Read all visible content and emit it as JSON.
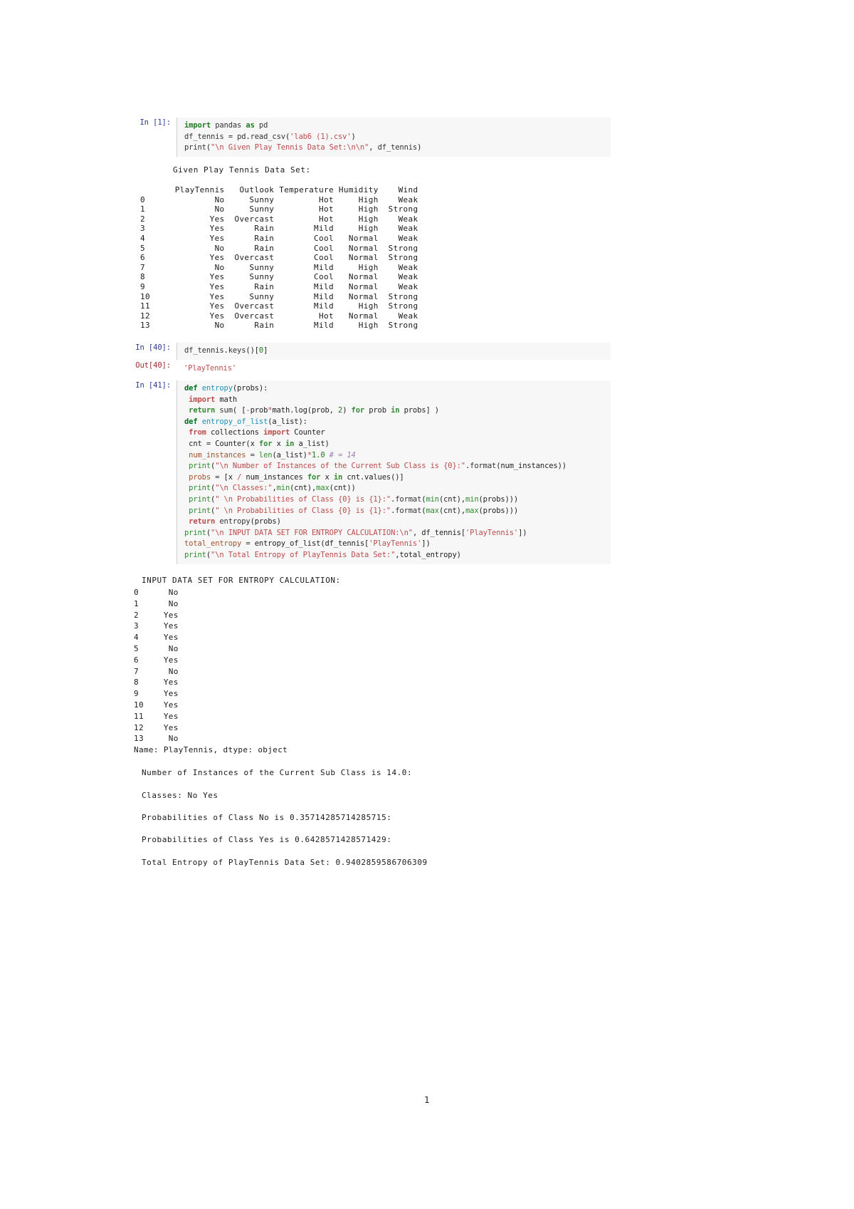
{
  "document": {
    "page_number": "1"
  },
  "cells": [
    {
      "prompt": "In [1]:",
      "code_lines": [
        "import pandas as pd",
        "df_tennis = pd.read_csv('lab6 (1).csv')",
        "print(\"\\n Given Play Tennis Data Set:\\n\\n\", df_tennis)"
      ]
    },
    {
      "prompt": "In [40]:",
      "code_lines": [
        "df_tennis.keys()[0]"
      ]
    },
    {
      "prompt": "Out[40]:",
      "code_lines": [
        "'PlayTennis'"
      ]
    },
    {
      "prompt": "In [41]:",
      "code_lines": [
        "def entropy(probs):",
        "  import math",
        "  return sum( [-prob*math.log(prob, 2) for prob in probs] )",
        "def entropy_of_list(a_list):",
        "  from collections import Counter",
        "  cnt = Counter(x for x in a_list)",
        "  num_instances = len(a_list)*1.0 # = 14",
        "  print(\"\\n Number of Instances of the Current Sub Class is {0}:\".format(num_instances))",
        "  probs = [x / num_instances for x in cnt.values()]",
        "  print(\"\\n Classes:\",min(cnt),max(cnt))",
        "  print(\" \\n Probabilities of Class {0} is {1}:\".format(min(cnt),min(probs)))",
        "  print(\" \\n Probabilities of Class {0} is {1}:\".format(max(cnt),max(probs)))",
        "  return entropy(probs)",
        "print(\"\\n INPUT DATA SET FOR ENTROPY CALCULATION:\\n\", df_tennis['PlayTennis'])",
        "total_entropy = entropy_of_list(df_tennis['PlayTennis'])",
        "print(\"\\n Total Entropy of PlayTennis Data Set:\",total_entropy)"
      ]
    }
  ],
  "output_dataset": {
    "title": "Given Play Tennis Data Set:",
    "columns": [
      "PlayTennis",
      "Outlook",
      "Temperature",
      "Humidity",
      "Wind"
    ],
    "index": [
      "0",
      "1",
      "2",
      "3",
      "4",
      "5",
      "6",
      "7",
      "8",
      "9",
      "10",
      "11",
      "12",
      "13"
    ],
    "rows": [
      [
        "No",
        "Sunny",
        "Hot",
        "High",
        "Weak"
      ],
      [
        "No",
        "Sunny",
        "Hot",
        "High",
        "Strong"
      ],
      [
        "Yes",
        "Overcast",
        "Hot",
        "High",
        "Weak"
      ],
      [
        "Yes",
        "Rain",
        "Mild",
        "High",
        "Weak"
      ],
      [
        "Yes",
        "Rain",
        "Cool",
        "Normal",
        "Weak"
      ],
      [
        "No",
        "Rain",
        "Cool",
        "Normal",
        "Strong"
      ],
      [
        "Yes",
        "Overcast",
        "Cool",
        "Normal",
        "Strong"
      ],
      [
        "No",
        "Sunny",
        "Mild",
        "High",
        "Weak"
      ],
      [
        "Yes",
        "Sunny",
        "Cool",
        "Normal",
        "Weak"
      ],
      [
        "Yes",
        "Rain",
        "Mild",
        "Normal",
        "Weak"
      ],
      [
        "Yes",
        "Sunny",
        "Mild",
        "Normal",
        "Strong"
      ],
      [
        "Yes",
        "Overcast",
        "Mild",
        "High",
        "Strong"
      ],
      [
        "Yes",
        "Overcast",
        "Hot",
        "Normal",
        "Weak"
      ],
      [
        "No",
        "Rain",
        "Mild",
        "High",
        "Strong"
      ]
    ],
    "text": "       PlayTennis   Outlook Temperature Humidity    Wind\n0              No     Sunny         Hot     High    Weak\n1              No     Sunny         Hot     High  Strong\n2             Yes  Overcast         Hot     High    Weak\n3             Yes      Rain        Mild     High    Weak\n4             Yes      Rain        Cool   Normal    Weak\n5              No      Rain        Cool   Normal  Strong\n6             Yes  Overcast        Cool   Normal  Strong\n7              No     Sunny        Mild     High    Weak\n8             Yes     Sunny        Cool   Normal    Weak\n9             Yes      Rain        Mild   Normal    Weak\n10            Yes     Sunny        Mild   Normal  Strong\n11            Yes  Overcast        Mild     High  Strong\n12            Yes  Overcast         Hot   Normal    Weak\n13             No      Rain        Mild     High  Strong"
  },
  "output_entropy": {
    "header": "INPUT DATA SET FOR ENTROPY CALCULATION:",
    "series": [
      [
        "0",
        "No"
      ],
      [
        "1",
        "No"
      ],
      [
        "2",
        "Yes"
      ],
      [
        "3",
        "Yes"
      ],
      [
        "4",
        "Yes"
      ],
      [
        "5",
        "No"
      ],
      [
        "6",
        "Yes"
      ],
      [
        "7",
        "No"
      ],
      [
        "8",
        "Yes"
      ],
      [
        "9",
        "Yes"
      ],
      [
        "10",
        "Yes"
      ],
      [
        "11",
        "Yes"
      ],
      [
        "12",
        "Yes"
      ],
      [
        "13",
        "No"
      ]
    ],
    "series_text": "0      No\n1      No\n2     Yes\n3     Yes\n4     Yes\n5      No\n6     Yes\n7      No\n8     Yes\n9     Yes\n10    Yes\n11    Yes\n12    Yes\n13     No",
    "name_line": "Name: PlayTennis, dtype: object",
    "num_instances_line": "Number of Instances of the Current Sub Class is 14.0:",
    "classes_line": "Classes: No Yes",
    "prob_no_line": "Probabilities of Class No is 0.35714285714285715:",
    "prob_yes_line": "Probabilities of Class Yes is 0.6428571428571429:",
    "total_entropy_line": "Total Entropy of PlayTennis Data Set: 0.9402859586706309"
  }
}
